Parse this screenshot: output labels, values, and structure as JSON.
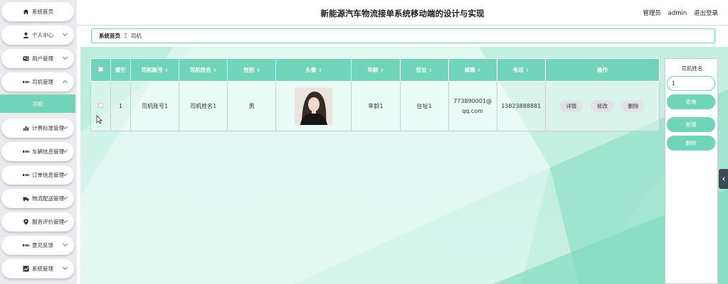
{
  "header": {
    "title": "新能源汽车物流接单系统移动端的设计与实现",
    "role": "管理员",
    "username": "admin",
    "logout": "退出登录"
  },
  "breadcrumb": {
    "home": "系统首页",
    "separator": "Ξ",
    "current": "司机"
  },
  "sidebar": {
    "items": [
      {
        "label": "系统首页",
        "icon": "home-icon"
      },
      {
        "label": "个人中心",
        "icon": "person-icon"
      },
      {
        "label": "用户管理",
        "icon": "user-card-icon"
      },
      {
        "label": "司机管理",
        "icon": "grid-icon"
      },
      {
        "label": "计费标准管理",
        "icon": "bar-chart-icon"
      },
      {
        "label": "车辆信息管理",
        "icon": "grid-icon"
      },
      {
        "label": "订单信息管理",
        "icon": "grid-icon"
      },
      {
        "label": "物流配送管理",
        "icon": "truck-icon"
      },
      {
        "label": "服务评价管理",
        "icon": "location-icon"
      },
      {
        "label": "意见反馈",
        "icon": "grid-icon"
      },
      {
        "label": "系统管理",
        "icon": "chart-box-icon"
      }
    ],
    "sub_item": "司机"
  },
  "table": {
    "headers": [
      "索引",
      "司机账号",
      "司机姓名",
      "性别",
      "头像",
      "年龄",
      "住址",
      "邮箱",
      "电话",
      "操作"
    ],
    "rows": [
      {
        "index": "1",
        "account": "司机账号1",
        "name": "司机姓名1",
        "gender": "男",
        "age": "年龄1",
        "address": "住址1",
        "email": "773890001@qq.com",
        "phone": "13823888881"
      }
    ],
    "actions": {
      "detail": "详情",
      "edit": "修改",
      "delete": "删除"
    }
  },
  "search_panel": {
    "label": "司机姓名",
    "input_value": "1",
    "search_button": "查询",
    "add_button": "新增",
    "delete_button": "删除"
  },
  "colors": {
    "accent": "#70d5b8",
    "background": "#cdf2e7"
  }
}
